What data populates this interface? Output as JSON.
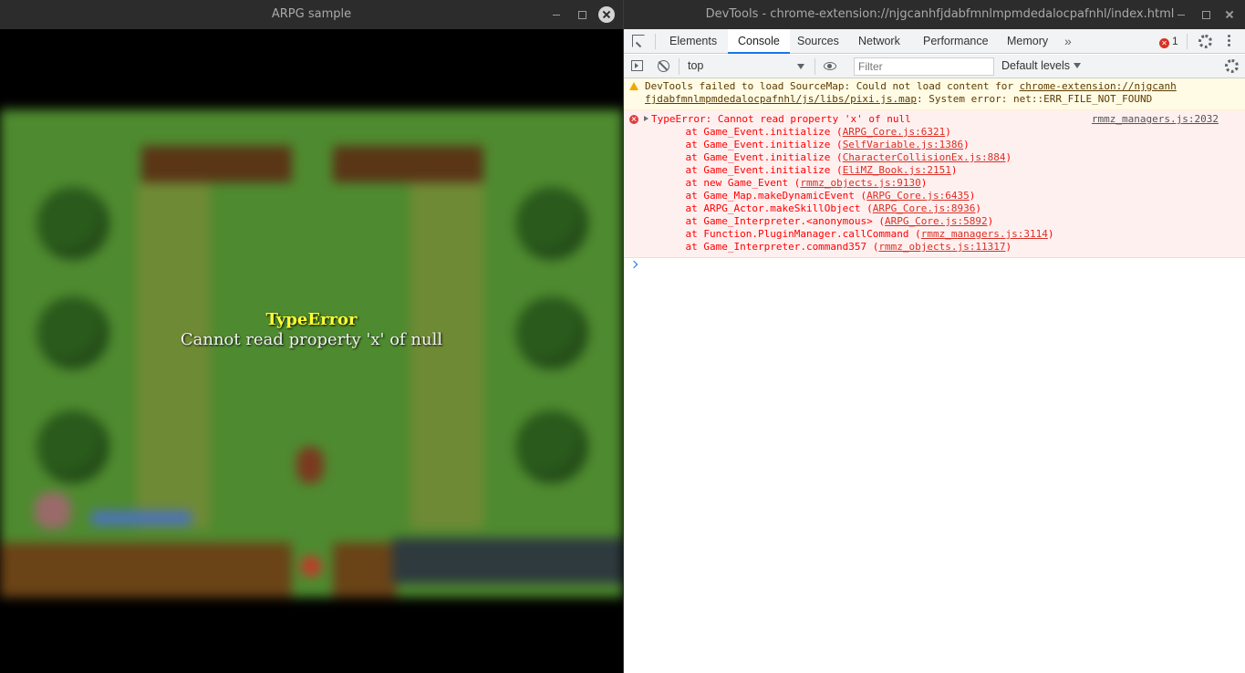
{
  "game_window": {
    "title": "ARPG sample",
    "error": {
      "title": "TypeError",
      "message": "Cannot read property 'x' of null"
    }
  },
  "devtools_window": {
    "title": "DevTools - chrome-extension://njgcanhfjdabfmnlmpmdedalocpafnhl/index.html",
    "tabs": [
      "Elements",
      "Console",
      "Sources",
      "Network",
      "Performance",
      "Memory"
    ],
    "active_tab": "Console",
    "more_tabs": "»",
    "error_count": "1",
    "toolbar": {
      "context": "top",
      "filter_placeholder": "Filter",
      "levels": "Default levels"
    },
    "warning": {
      "text_prefix": "DevTools failed to load SourceMap: Could not load content for ",
      "link_line1": "chrome-extension://njgcanh",
      "link_line2": "fjdabfmnlmpmdedalocpafnhl/js/libs/pixi.js.map",
      "text_suffix": ": System error: net::ERR_FILE_NOT_FOUND"
    },
    "error": {
      "message": "TypeError: Cannot read property 'x' of null",
      "source": "rmmz_managers.js:2032",
      "stack": [
        {
          "prefix": "    at Game_Event.initialize (",
          "link": "ARPG_Core.js:6321",
          "suffix": ")"
        },
        {
          "prefix": "    at Game_Event.initialize (",
          "link": "SelfVariable.js:1386",
          "suffix": ")"
        },
        {
          "prefix": "    at Game_Event.initialize (",
          "link": "CharacterCollisionEx.js:884",
          "suffix": ")"
        },
        {
          "prefix": "    at Game_Event.initialize (",
          "link": "EliMZ_Book.js:2151",
          "suffix": ")"
        },
        {
          "prefix": "    at new Game_Event (",
          "link": "rmmz_objects.js:9130",
          "suffix": ")"
        },
        {
          "prefix": "    at Game_Map.makeDynamicEvent (",
          "link": "ARPG_Core.js:6435",
          "suffix": ")"
        },
        {
          "prefix": "    at ARPG_Actor.makeSkillObject (",
          "link": "ARPG_Core.js:8936",
          "suffix": ")"
        },
        {
          "prefix": "    at Game_Interpreter.<anonymous> (",
          "link": "ARPG_Core.js:5892",
          "suffix": ")"
        },
        {
          "prefix": "    at Function.PluginManager.callCommand (",
          "link": "rmmz_managers.js:3114",
          "suffix": ")"
        },
        {
          "prefix": "    at Game_Interpreter.command357 (",
          "link": "rmmz_objects.js:11317",
          "suffix": ")"
        }
      ]
    }
  }
}
